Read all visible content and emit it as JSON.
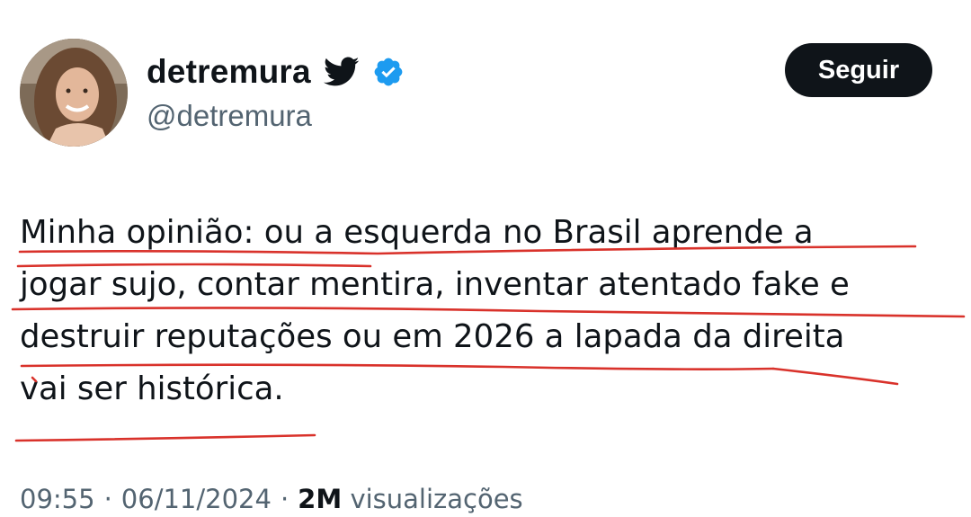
{
  "author": {
    "display_name": "detremura",
    "handle": "@detremura",
    "avatar_icon": "avatar-photo",
    "bird_icon": "twitter-bird-icon",
    "verified_icon": "verified-badge-icon",
    "verified_color": "#1d9bf0"
  },
  "follow_button": {
    "label": "Seguir"
  },
  "tweet": {
    "lines": [
      "Minha opinião: ou a esquerda no Brasil aprende a",
      "jogar sujo, contar mentira, inventar atentado fake e",
      "destruir reputações ou em 2026 a lapada da direita",
      "vai ser histórica."
    ],
    "annotation_color": "#d9322b"
  },
  "meta": {
    "time": "09:55",
    "separator": "·",
    "date": "06/11/2024",
    "views_count": "2M",
    "views_label": "visualizações"
  }
}
